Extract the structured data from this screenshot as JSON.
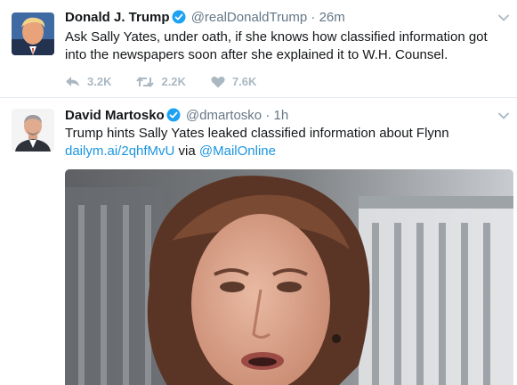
{
  "tweets": [
    {
      "name": "Donald J. Trump",
      "handle": "@realDonaldTrump",
      "separator": "·",
      "time": "26m",
      "text": "Ask Sally Yates, under oath, if she knows how classified information got into the newspapers soon after she explained it to W.H. Counsel.",
      "reply_count": "3.2K",
      "retweet_count": "2.2K",
      "like_count": "7.6K"
    },
    {
      "name": "David Martosko",
      "handle": "@dmartosko",
      "separator": "·",
      "time": "1h",
      "text_main": "Trump hints Sally Yates leaked classified information about Flynn ",
      "link1": "dailym.ai/2qhfMvU",
      "via": " via ",
      "link2": "@MailOnline"
    }
  ],
  "colors": {
    "link": "#1b95e0",
    "verified": "#1da1f2",
    "muted": "#657786",
    "action": "#aab8c2"
  },
  "icons": [
    "verified-badge-icon",
    "caret-down-icon",
    "reply-icon",
    "retweet-icon",
    "like-heart-icon"
  ]
}
